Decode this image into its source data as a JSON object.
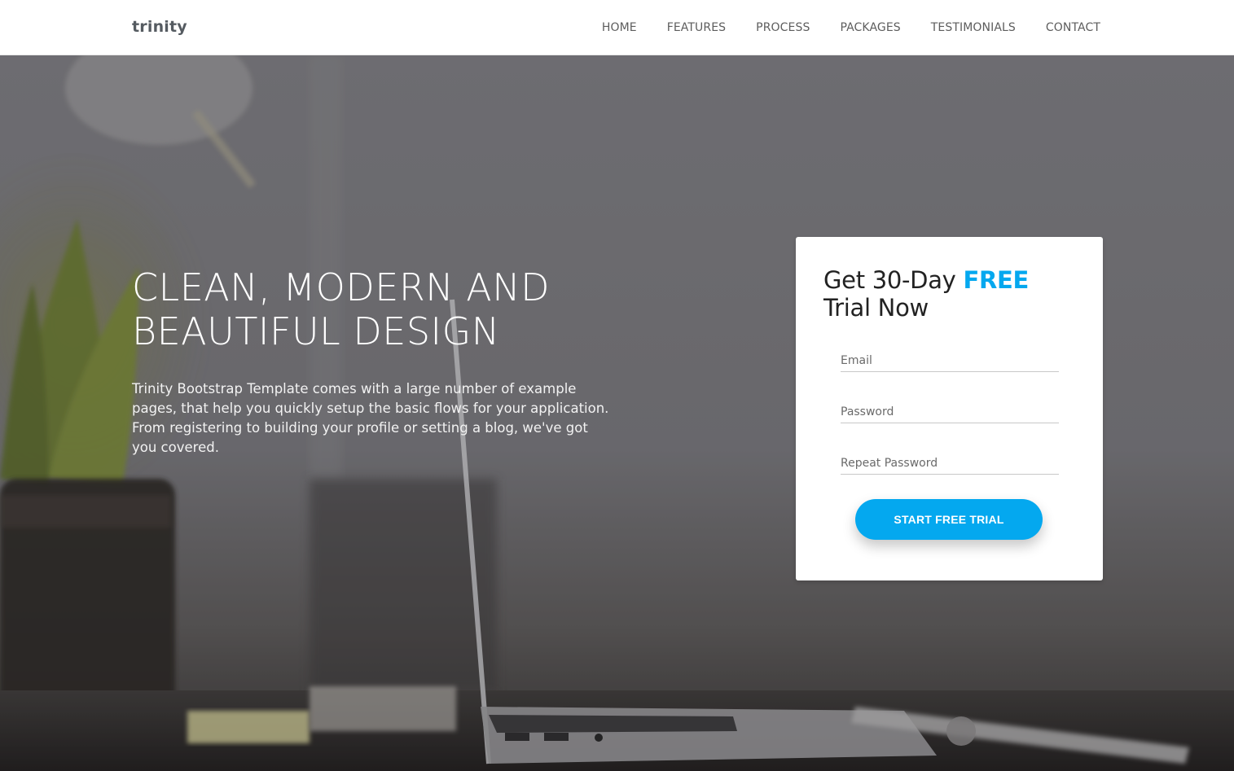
{
  "nav": {
    "brand": "trinity",
    "links": [
      {
        "label": "HOME"
      },
      {
        "label": "FEATURES"
      },
      {
        "label": "PROCESS"
      },
      {
        "label": "PACKAGES"
      },
      {
        "label": "TESTIMONIALS"
      },
      {
        "label": "CONTACT"
      }
    ]
  },
  "hero": {
    "title_line1": "CLEAN, MODERN AND",
    "title_line2": "BEAUTIFUL DESIGN",
    "description": "Trinity Bootstrap Template comes with a large number of example pages, that help you quickly setup the basic flows for your application. From registering to building your profile or setting a blog, we've got you covered."
  },
  "signup": {
    "title_prefix": "Get 30-Day ",
    "title_accent": "FREE",
    "title_suffix": "Trial Now",
    "email_placeholder": "Email",
    "password_placeholder": "Password",
    "repeat_password_placeholder": "Repeat Password",
    "submit_label": "START FREE TRIAL"
  },
  "colors": {
    "accent": "#04a8ef",
    "nav_text": "#5d5d5d"
  }
}
